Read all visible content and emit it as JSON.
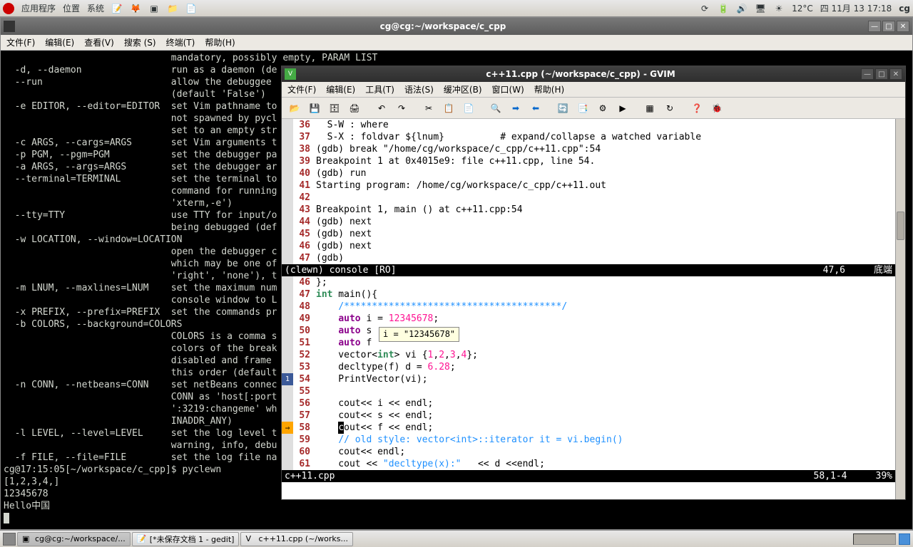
{
  "panel": {
    "apps": "应用程序",
    "places": "位置",
    "system": "系统",
    "temp": "12°C",
    "date": "四 11月 13 17:18",
    "user": "cg"
  },
  "terminal": {
    "title": "cg@cg:~/workspace/c_cpp",
    "menu": {
      "file": "文件(F)",
      "edit": "编辑(E)",
      "view": "查看(V)",
      "search": "搜索 (S)",
      "terminal": "终端(T)",
      "help": "帮助(H)"
    },
    "lines": [
      "                              mandatory, possibly empty, PARAM LIST",
      "  -d, --daemon                run as a daemon (de",
      "  --run                       allow the debuggee ",
      "                              (default 'False')",
      "  -e EDITOR, --editor=EDITOR  set Vim pathname to",
      "                              not spawned by pycl",
      "                              set to an empty str",
      "  -c ARGS, --cargs=ARGS       set Vim arguments t",
      "  -p PGM, --pgm=PGM           set the debugger pa",
      "  -a ARGS, --args=ARGS        set the debugger ar",
      "  --terminal=TERMINAL         set the terminal to",
      "                              command for running",
      "                              'xterm,-e')",
      "  --tty=TTY                   use TTY for input/o",
      "                              being debugged (def",
      "  -w LOCATION, --window=LOCATION",
      "                              open the debugger c",
      "                              which may be one of",
      "                              'right', 'none'), t",
      "  -m LNUM, --maxlines=LNUM    set the maximum num",
      "                              console window to L",
      "  -x PREFIX, --prefix=PREFIX  set the commands pr",
      "  -b COLORS, --background=COLORS",
      "                              COLORS is a comma s",
      "                              colors of the break",
      "                              disabled and frame ",
      "                              this order (default",
      "  -n CONN, --netbeans=CONN    set netBeans connec",
      "                              CONN as 'host[:port",
      "                              ':3219:changeme' wh",
      "                              INADDR_ANY)",
      "  -l LEVEL, --level=LEVEL     set the log level t",
      "                              warning, info, debu",
      "  -f FILE, --file=FILE        set the log file na",
      "cg@17:15:05[~/workspace/c_cpp]$ pyclewn",
      "[1,2,3,4,]",
      "12345678",
      "Hello中国"
    ]
  },
  "gvim": {
    "title": "c++11.cpp (~/workspace/c_cpp) - GVIM",
    "menu": {
      "file": "文件(F)",
      "edit": "编辑(E)",
      "tools": "工具(T)",
      "syntax": "语法(S)",
      "buffers": "缓冲区(B)",
      "window": "窗口(W)",
      "help": "帮助(H)"
    },
    "console": [
      {
        "n": "36",
        "t": "  S-W : where"
      },
      {
        "n": "37",
        "t": "  S-X : foldvar ${lnum}          # expand/collapse a watched variable"
      },
      {
        "n": "38",
        "t": "(gdb) break \"/home/cg/workspace/c_cpp/c++11.cpp\":54"
      },
      {
        "n": "39",
        "t": "Breakpoint 1 at 0x4015e9: file c++11.cpp, line 54."
      },
      {
        "n": "40",
        "t": "(gdb) run"
      },
      {
        "n": "41",
        "t": "Starting program: /home/cg/workspace/c_cpp/c++11.out"
      },
      {
        "n": "42",
        "t": ""
      },
      {
        "n": "43",
        "t": "Breakpoint 1, main () at c++11.cpp:54"
      },
      {
        "n": "44",
        "t": "(gdb) next"
      },
      {
        "n": "45",
        "t": "(gdb) next"
      },
      {
        "n": "46",
        "t": "(gdb) next"
      },
      {
        "n": "47",
        "t": "(gdb)"
      }
    ],
    "status1": {
      "left": "(clewn) console [RO]",
      "pos": "47,6",
      "mode": "底端"
    },
    "status2": {
      "left": "c++11.cpp",
      "pos": "58,1-4",
      "mode": "39%"
    },
    "tooltip": "i = \"12345678\""
  },
  "taskbar": {
    "t1": "cg@cg:~/workspace/...",
    "t2": "[*未保存文档 1 - gedit]",
    "t3": "c++11.cpp (~/works..."
  }
}
